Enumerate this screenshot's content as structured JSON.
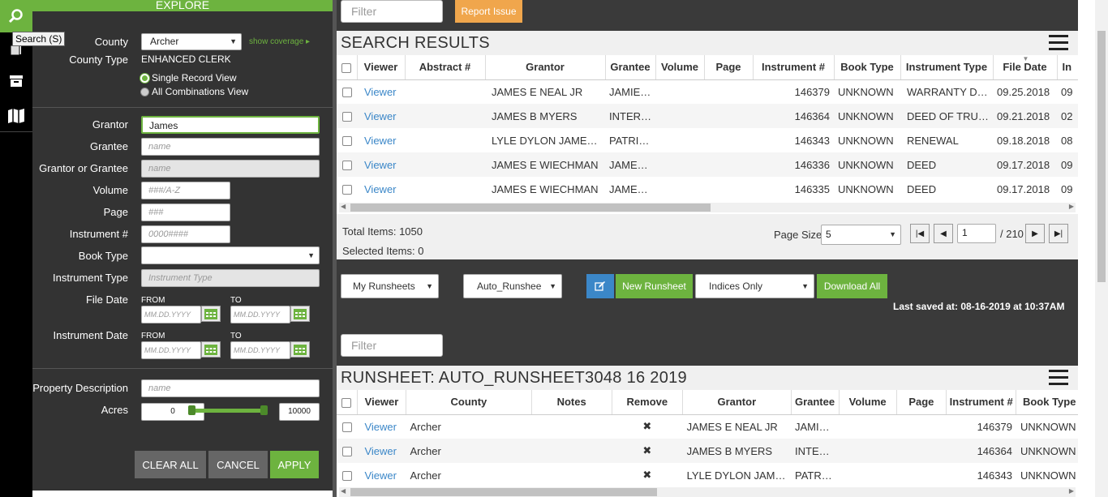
{
  "rail": {
    "tooltip": "Search (S)"
  },
  "explore": {
    "title": "EXPLORE",
    "county_label": "County",
    "county_value": "Archer",
    "show_coverage": "show coverage",
    "county_type_label": "County Type",
    "county_type_value": "ENHANCED CLERK",
    "view_single": "Single Record View",
    "view_all": "All Combinations View",
    "grantor_label": "Grantor",
    "grantor_value": "James",
    "grantee_label": "Grantee",
    "grantee_ph": "name",
    "gog_label": "Grantor or Grantee",
    "gog_ph": "name",
    "volume_label": "Volume",
    "volume_ph": "###/A-Z",
    "page_label": "Page",
    "page_ph": "###",
    "instrument_label": "Instrument #",
    "instrument_ph": "0000####",
    "book_type_label": "Book Type",
    "instrument_type_label": "Instrument Type",
    "instrument_type_ph": "Instrument Type",
    "file_date_label": "File Date",
    "instrument_date_label": "Instrument Date",
    "from": "FROM",
    "to": "TO",
    "date_ph": "MM.DD.YYYY",
    "property_desc_label": "Property Description",
    "property_desc_ph": "name",
    "acres_label": "Acres",
    "acres_min": "0",
    "acres_max": "10000",
    "clear_all": "CLEAR ALL",
    "cancel": "CANCEL",
    "apply": "APPLY"
  },
  "topbar": {
    "filter_ph": "Filter",
    "report_issue": "Report Issue"
  },
  "search_results": {
    "title": "SEARCH RESULTS",
    "columns": [
      "Viewer",
      "Abstract #",
      "Grantor",
      "Grantee",
      "Volume",
      "Page",
      "Instrument #",
      "Book Type",
      "Instrument Type",
      "File Date",
      "In"
    ],
    "rows": [
      {
        "viewer": "Viewer",
        "abstract": "",
        "grantor": "JAMES E NEAL JR",
        "grantee": "JAMIE E NEAL",
        "volume": "",
        "page": "",
        "instrument": "146379",
        "book_type": "UNKNOWN",
        "instrument_type": "WARRANTY DEED",
        "file_date": "09.25.2018",
        "inst_date": "09"
      },
      {
        "viewer": "Viewer",
        "abstract": "",
        "grantor": "JAMES B MYERS",
        "grantee": "INTERBANK",
        "volume": "",
        "page": "",
        "instrument": "146364",
        "book_type": "UNKNOWN",
        "instrument_type": "DEED OF TRUST",
        "file_date": "09.21.2018",
        "inst_date": "02"
      },
      {
        "viewer": "Viewer",
        "abstract": "",
        "grantor": "LYLE DYLON JAMES ...",
        "grantee": "PATRICIA",
        "volume": "",
        "page": "",
        "instrument": "146343",
        "book_type": "UNKNOWN",
        "instrument_type": "RENEWAL",
        "file_date": "09.18.2018",
        "inst_date": "08"
      },
      {
        "viewer": "Viewer",
        "abstract": "",
        "grantor": "JAMES E WIECHMAN",
        "grantee": "JAMES E WIECHMAN",
        "volume": "",
        "page": "",
        "instrument": "146336",
        "book_type": "UNKNOWN",
        "instrument_type": "DEED",
        "file_date": "09.17.2018",
        "inst_date": "09"
      },
      {
        "viewer": "Viewer",
        "abstract": "",
        "grantor": "JAMES E WIECHMAN",
        "grantee": "JAMES E WIECHMAN",
        "volume": "",
        "page": "",
        "instrument": "146335",
        "book_type": "UNKNOWN",
        "instrument_type": "DEED",
        "file_date": "09.17.2018",
        "inst_date": "09"
      }
    ],
    "total_items": "Total Items: 1050",
    "selected_items": "Selected Items: 0",
    "page_size_label": "Page Size:",
    "page_size_value": "5",
    "page_current": "1",
    "page_total": "/ 210"
  },
  "runsheet_bar": {
    "my_runsheets": "My Runsheets",
    "auto_runsheet": "Auto_Runshee",
    "new_runsheet": "New Runsheet",
    "indices_only": "Indices Only",
    "download_all": "Download All",
    "last_saved": "Last saved at: 08-16-2019 at 10:37AM",
    "filter_ph": "Filter"
  },
  "runsheet": {
    "title": "RUNSHEET: AUTO_RUNSHEET3048 16 2019",
    "columns": [
      "Viewer",
      "County",
      "Notes",
      "Remove",
      "Grantor",
      "Grantee",
      "Volume",
      "Page",
      "Instrument #",
      "Book Type"
    ],
    "rows": [
      {
        "viewer": "Viewer",
        "county": "Archer",
        "notes": "",
        "remove": "✖",
        "grantor": "JAMES E NEAL JR",
        "grantee": "JAMIE E NEAL",
        "volume": "",
        "page": "",
        "instrument": "146379",
        "book_type": "UNKNOWN"
      },
      {
        "viewer": "Viewer",
        "county": "Archer",
        "notes": "",
        "remove": "✖",
        "grantor": "JAMES B MYERS",
        "grantee": "INTERBANK",
        "volume": "",
        "page": "",
        "instrument": "146364",
        "book_type": "UNKNOWN"
      },
      {
        "viewer": "Viewer",
        "county": "Archer",
        "notes": "",
        "remove": "✖",
        "grantor": "LYLE DYLON JAMES ...",
        "grantee": "PATRICIA",
        "volume": "",
        "page": "",
        "instrument": "146343",
        "book_type": "UNKNOWN"
      }
    ]
  }
}
